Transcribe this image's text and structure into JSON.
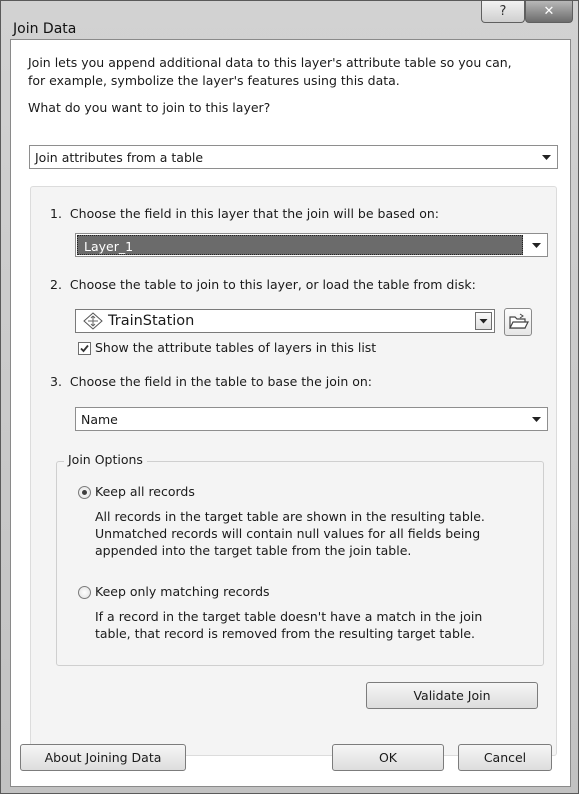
{
  "window": {
    "title": "Join Data",
    "help_glyph": "?",
    "close_glyph": "✕"
  },
  "intro": {
    "line1": "Join lets you append additional data to this layer's attribute table so you can,",
    "line2": "for example, symbolize the layer's features using this data.",
    "question": "What do you want to join to this layer?"
  },
  "join_type": {
    "value": "Join attributes from a table"
  },
  "step1": {
    "number": "1.",
    "label": "Choose the field in this layer that the join will be based on:",
    "value": "Layer_1"
  },
  "step2": {
    "number": "2.",
    "label": "Choose the table to join to this layer, or load the table from disk:",
    "value": "TrainStation",
    "checkbox_label": "Show the attribute tables of layers in this list",
    "checkbox_checked": true
  },
  "step3": {
    "number": "3.",
    "label": "Choose the field in the table to base the join on:",
    "value": "Name"
  },
  "join_options": {
    "legend": "Join Options",
    "keep_all": {
      "label": "Keep all records",
      "selected": true,
      "desc1": "All records in the target table are shown in the resulting table.",
      "desc2": "Unmatched records will contain null values for all fields being",
      "desc3": "appended into the target table from the join table."
    },
    "keep_matching": {
      "label": "Keep only matching records",
      "selected": false,
      "desc1": "If a record in the target table doesn't have a match in the join",
      "desc2": "table, that record is removed from the resulting target table."
    }
  },
  "buttons": {
    "validate": "Validate Join",
    "about": "About Joining Data",
    "ok": "OK",
    "cancel": "Cancel"
  },
  "icons": {
    "help": "help-icon",
    "close": "close-icon",
    "dropdown": "chevron-down-icon",
    "layer": "layer-icon",
    "folder": "folder-open-icon",
    "checkbox": "checkmark-icon"
  },
  "colors": {
    "selection": "#6b6b6b",
    "close_button": "#7a7a7a"
  }
}
